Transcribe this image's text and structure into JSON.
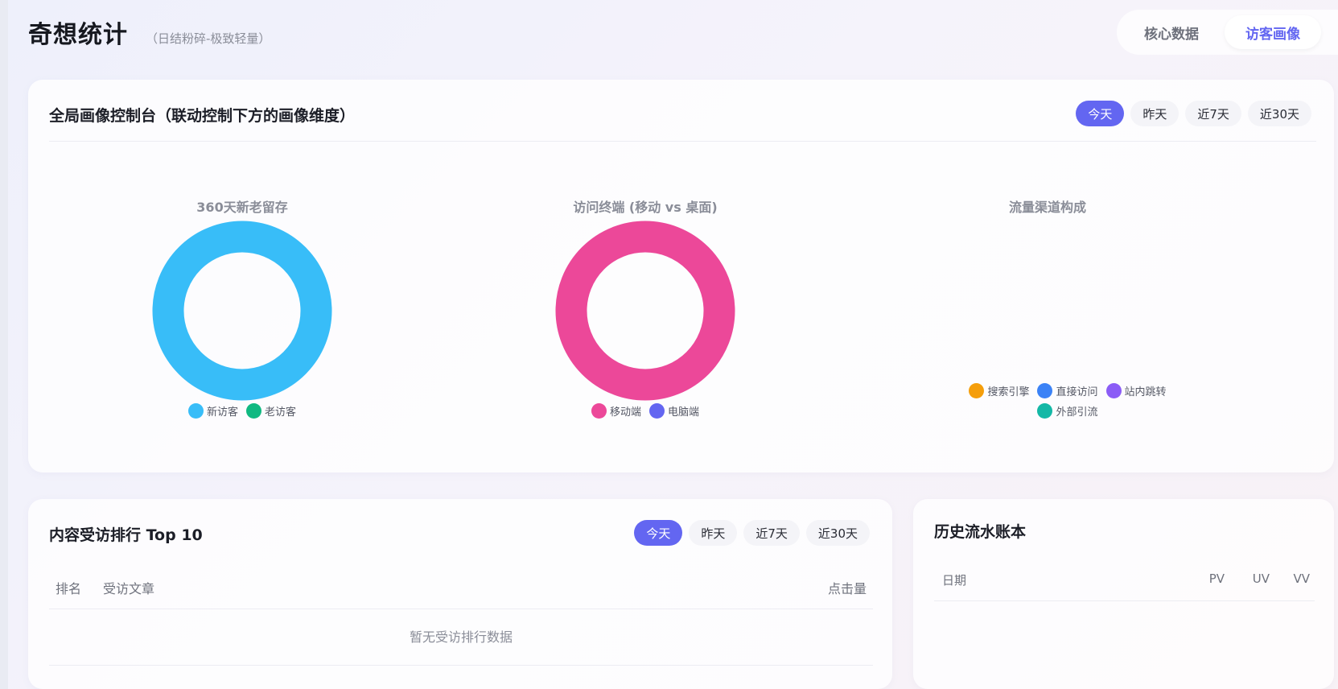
{
  "app": {
    "title": "奇想统计",
    "subtitle": "（日结粉碎-极致轻量）"
  },
  "top_tabs": [
    {
      "label": "核心数据",
      "active": false
    },
    {
      "label": "访客画像",
      "active": true
    }
  ],
  "console": {
    "title": "全局画像控制台（联动控制下方的画像维度）",
    "ranges": [
      "今天",
      "昨天",
      "近7天",
      "近30天"
    ],
    "active_range": "今天"
  },
  "chart_data": [
    {
      "type": "pie",
      "title": "360天新老留存",
      "categories": [
        "新访客",
        "老访客"
      ],
      "values": [
        1,
        0
      ],
      "colors": [
        "#38bdf8",
        "#10b981"
      ]
    },
    {
      "type": "pie",
      "title": "访问终端 (移动 vs 桌面)",
      "categories": [
        "移动端",
        "电脑端"
      ],
      "values": [
        1,
        0
      ],
      "colors": [
        "#ec4899",
        "#6366f1"
      ]
    },
    {
      "type": "pie",
      "title": "流量渠道构成",
      "categories": [
        "搜索引擎",
        "直接访问",
        "站内跳转",
        "外部引流"
      ],
      "values": [
        0,
        0,
        0,
        0
      ],
      "colors": [
        "#f59e0b",
        "#3b82f6",
        "#8b5cf6",
        "#14b8a6"
      ]
    }
  ],
  "rank": {
    "title": "内容受访排行 Top 10",
    "ranges": [
      "今天",
      "昨天",
      "近7天",
      "近30天"
    ],
    "active_range": "今天",
    "columns": [
      "排名",
      "受访文章",
      "点击量"
    ],
    "empty_text": "暂无受访排行数据"
  },
  "history": {
    "title": "历史流水账本",
    "columns": [
      "日期",
      "PV",
      "UV",
      "VV"
    ]
  }
}
